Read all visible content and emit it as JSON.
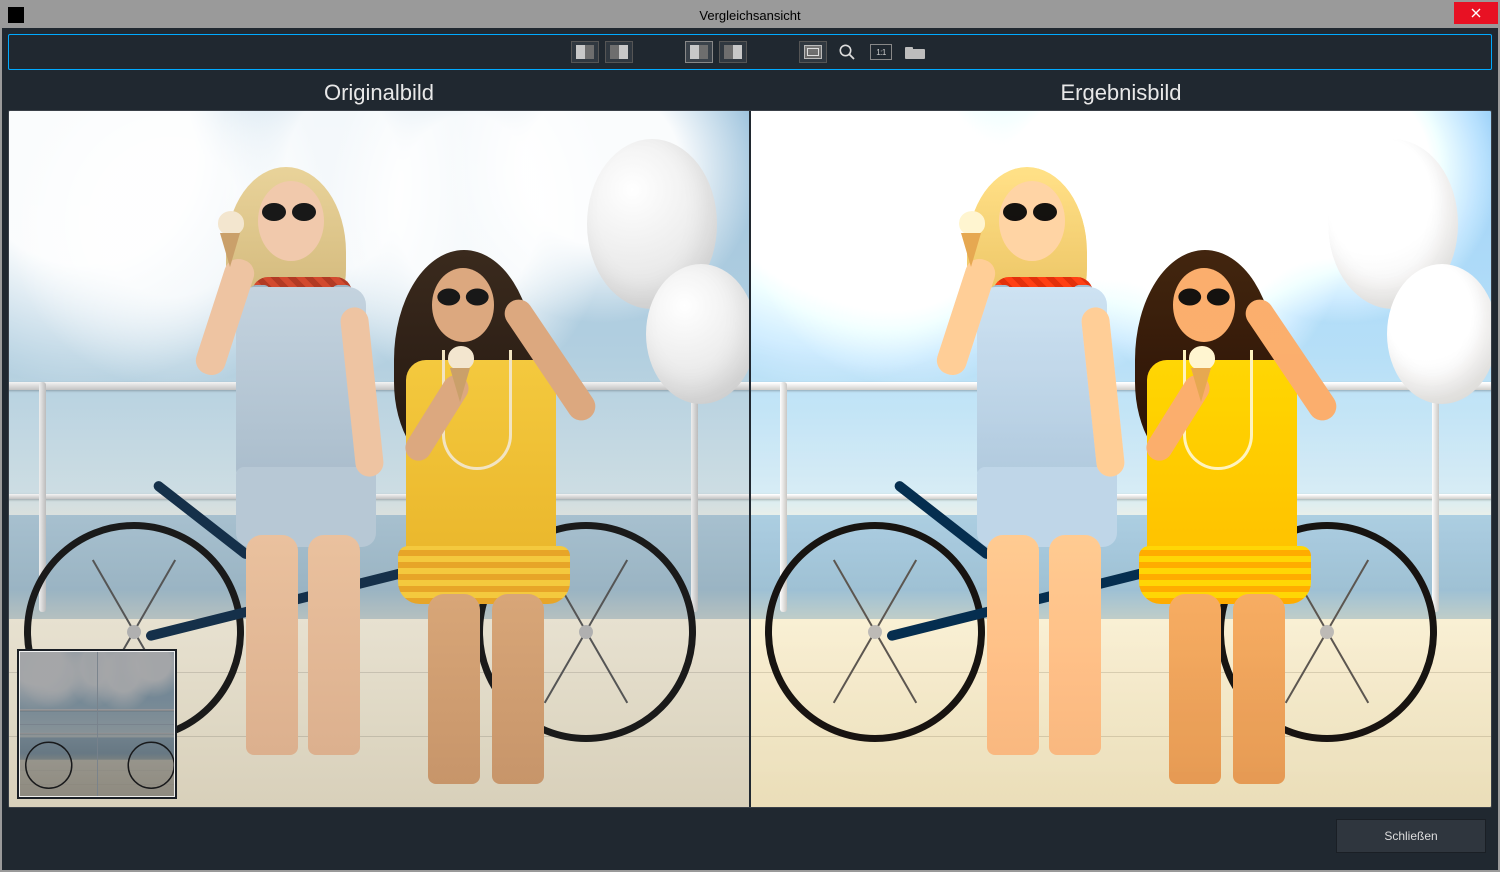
{
  "window": {
    "title": "Vergleichsansicht"
  },
  "panes": {
    "left_title": "Originalbild",
    "right_title": "Ergebnisbild"
  },
  "toolbar": {
    "layout_side_by_side": "side-by-side",
    "layout_split": "split",
    "layout_side_by_side_active": "side-by-side-active",
    "layout_split_alt": "split-alt",
    "fit_to_screen": "fit-to-screen",
    "zoom": "zoom",
    "one_to_one_label": "1:1",
    "open_folder": "open-folder"
  },
  "footer": {
    "close_label": "Schließen"
  }
}
